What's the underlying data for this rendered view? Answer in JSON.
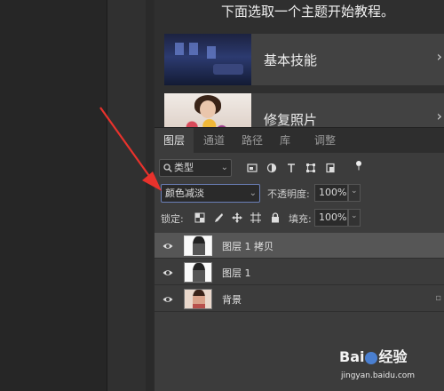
{
  "learn": {
    "title": "下面选取一个主题开始教程。",
    "cards": [
      {
        "label": "基本技能",
        "chevron": "›"
      },
      {
        "label": "修复照片",
        "chevron": "›"
      }
    ]
  },
  "layers_panel": {
    "tabs": [
      "图层",
      "通道",
      "路径",
      "库",
      "调整"
    ],
    "active_tab": "图层",
    "filter": {
      "value": "类型",
      "icon": "search-icon"
    },
    "blend_mode": {
      "value": "颜色减淡"
    },
    "opacity": {
      "label": "不透明度:",
      "value": "100%"
    },
    "lock": {
      "label": "锁定:"
    },
    "fill": {
      "label": "填充:",
      "value": "100%"
    },
    "layers": [
      {
        "name": "图层 1 拷贝",
        "selected": true
      },
      {
        "name": "图层 1",
        "selected": false
      },
      {
        "name": "背景",
        "selected": false
      }
    ]
  },
  "annotation": {
    "arrow_color": "#e8322c"
  },
  "watermark": {
    "logo_a": "Bai",
    "logo_b": "经验",
    "site": "jingyan.baidu.com"
  }
}
